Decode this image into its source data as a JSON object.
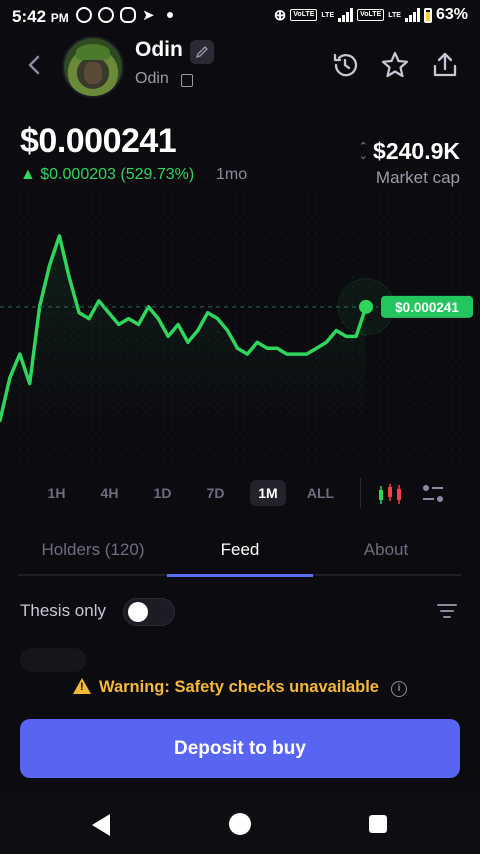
{
  "status_bar": {
    "time": "5:42",
    "ampm": "PM",
    "volte1": "VoLTE",
    "volte2": "VoLTE",
    "lte": "LTE",
    "battery": "63%"
  },
  "header": {
    "token_name": "Odin",
    "ticker": "Odin"
  },
  "price": {
    "current": "$0.000241",
    "change": "▲ $0.000203 (529.73%)",
    "period": "1mo",
    "market_cap": "$240.9K",
    "market_cap_label": "Market cap"
  },
  "chart_data": {
    "type": "line",
    "series": [
      {
        "values": [
          4.8e-05,
          0.00012,
          0.00016,
          0.00011,
          0.00024,
          0.00031,
          0.00036,
          0.00029,
          0.00023,
          0.00022,
          0.00025,
          0.00023,
          0.00021,
          0.00022,
          0.00021,
          0.00024,
          0.00022,
          0.00019,
          0.00021,
          0.00018,
          0.0002,
          0.00023,
          0.00022,
          0.0002,
          0.00017,
          0.00016,
          0.00018,
          0.00017,
          0.00017,
          0.00016,
          0.00016,
          0.00016,
          0.00017,
          0.00018,
          0.0002,
          0.00019,
          0.00019,
          0.00024
        ],
        "color": "#2fd65b"
      }
    ],
    "price_label": "$0.000241",
    "grid": false
  },
  "time_ranges": [
    "1H",
    "4H",
    "1D",
    "7D",
    "1M",
    "ALL"
  ],
  "active_range": "1M",
  "tabs": [
    "Holders (120)",
    "Feed",
    "About"
  ],
  "active_tab": "Feed",
  "feed": {
    "thesis_label": "Thesis only",
    "thesis_enabled": false
  },
  "warning": {
    "text": "Warning: Safety checks unavailable"
  },
  "cta": {
    "label": "Deposit to buy"
  },
  "colors": {
    "accent": "#5865f2",
    "positive": "#2fd65b",
    "warning": "#f5b83a",
    "background": "#0b0b10"
  }
}
